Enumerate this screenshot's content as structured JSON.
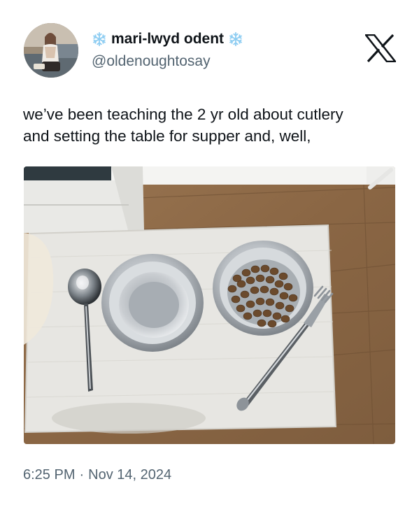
{
  "author": {
    "display_name": "mari-lwyd odent",
    "handle": "@oldenoughtosay"
  },
  "icons": {
    "name_decoration": "snowflake-icon",
    "brand": "x-logo-icon"
  },
  "tweet": {
    "text_lines": [
      "we’ve been teaching the 2 yr old about cutlery",
      "and setting the table for supper and, well,"
    ]
  },
  "meta": {
    "time": "6:25 PM",
    "separator": "·",
    "date": "Nov 14, 2024"
  },
  "colors": {
    "text": "#0f1419",
    "secondary": "#536471",
    "snowflake": "#8ecdf2"
  }
}
